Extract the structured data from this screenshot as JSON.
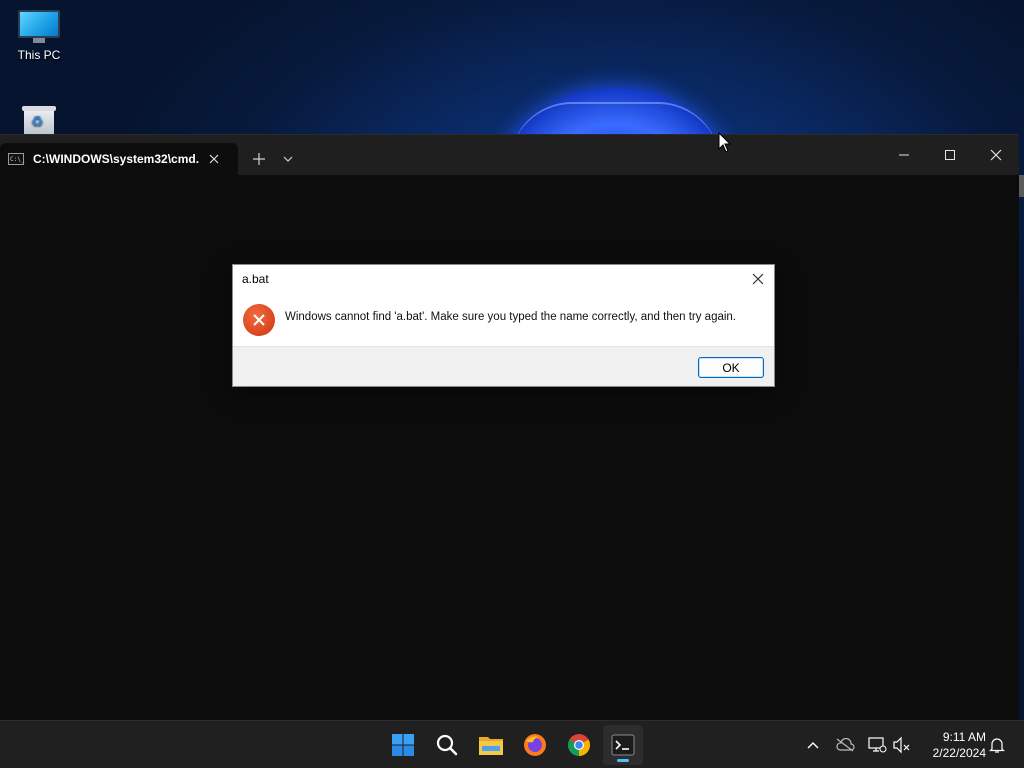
{
  "desktop": {
    "icons": [
      {
        "label": "This PC",
        "icon": "monitor-icon"
      },
      {
        "label": "",
        "icon": "recycle-bin-icon"
      }
    ]
  },
  "terminal": {
    "tab": {
      "title": "C:\\WINDOWS\\system32\\cmd.",
      "icon": "cmd-icon"
    },
    "controls": {
      "new_tab": "new-tab-icon",
      "dropdown": "chevron-down-icon",
      "minimize": "minimize-icon",
      "maximize": "maximize-icon",
      "close": "close-icon"
    }
  },
  "dialog": {
    "title": "a.bat",
    "message": "Windows cannot find 'a.bat'. Make sure you typed the name correctly, and then try again.",
    "ok_label": "OK",
    "icon": "error-icon",
    "accent_color": "#0067c0",
    "error_color": "#d9451d"
  },
  "taskbar": {
    "apps": [
      {
        "name": "Start",
        "icon": "windows-start-icon"
      },
      {
        "name": "Search",
        "icon": "search-icon"
      },
      {
        "name": "File Explorer",
        "icon": "folder-icon"
      },
      {
        "name": "Firefox",
        "icon": "firefox-icon"
      },
      {
        "name": "Chrome",
        "icon": "chrome-icon"
      },
      {
        "name": "Terminal",
        "icon": "terminal-icon",
        "active": true
      }
    ],
    "tray": {
      "icons": [
        "chevron-up-icon",
        "cloud-off-icon",
        "network-icon",
        "volume-muted-icon",
        "notification-bell-icon"
      ],
      "time": "9:11 AM",
      "date": "2/22/2024"
    }
  }
}
